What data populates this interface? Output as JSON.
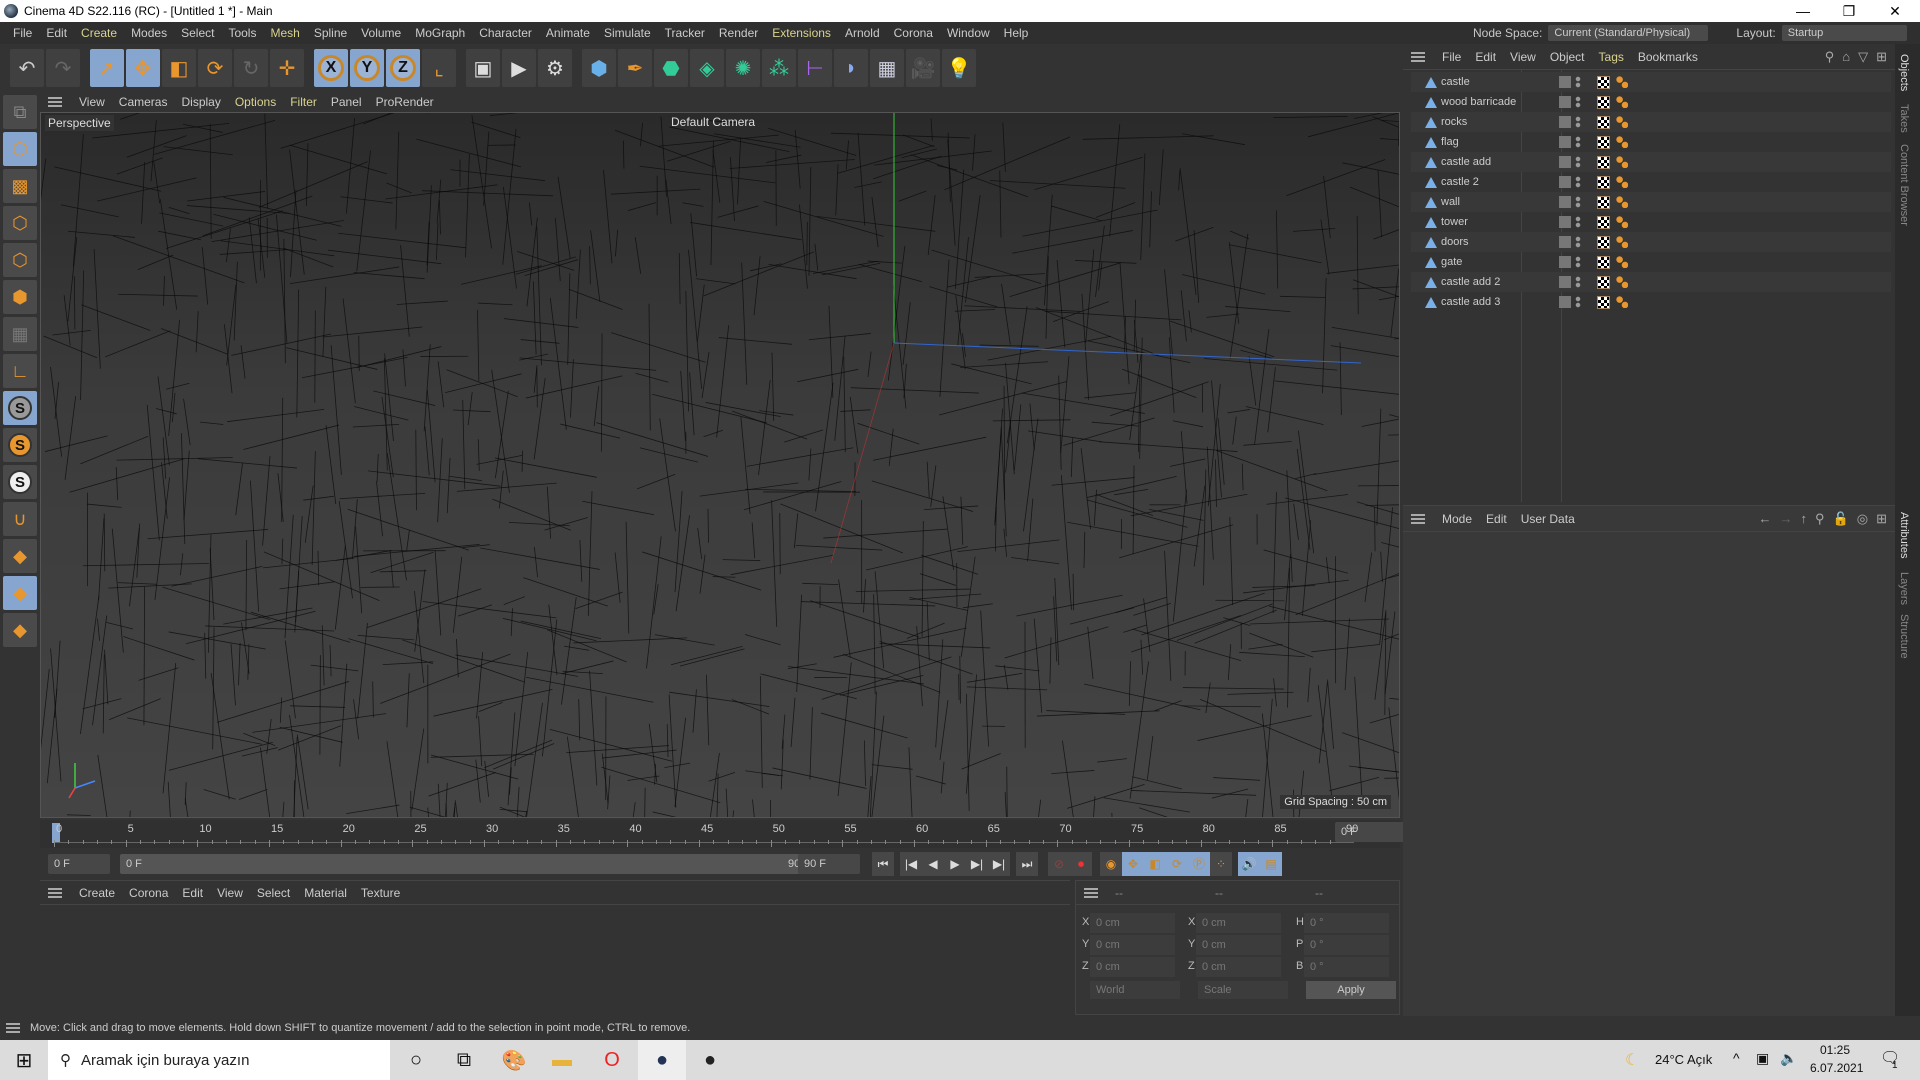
{
  "window": {
    "title": "Cinema 4D S22.116 (RC) - [Untitled 1 *] - Main",
    "minimize": "—",
    "restore": "❐",
    "close": "✕"
  },
  "menubar": [
    "File",
    "Edit",
    "Create",
    "Modes",
    "Select",
    "Tools",
    "Mesh",
    "Spline",
    "Volume",
    "MoGraph",
    "Character",
    "Animate",
    "Simulate",
    "Tracker",
    "Render",
    "Extensions",
    "Arnold",
    "Corona",
    "Window",
    "Help"
  ],
  "menubar_highlight": [
    "Create",
    "Mesh",
    "Extensions"
  ],
  "node_space": {
    "label": "Node Space:",
    "value": "Current (Standard/Physical)"
  },
  "layout": {
    "label": "Layout:",
    "value": "Startup"
  },
  "toolbar": {
    "x": "X",
    "y": "Y",
    "z": "Z"
  },
  "viewport": {
    "menu": [
      "View",
      "Cameras",
      "Display",
      "Options",
      "Filter",
      "Panel",
      "ProRender"
    ],
    "view_name": "Perspective",
    "camera": "Default Camera",
    "grid_spacing": "Grid Spacing : 50 cm"
  },
  "timeline": {
    "ticks": [
      "0",
      "5",
      "10",
      "15",
      "20",
      "25",
      "30",
      "35",
      "40",
      "45",
      "50",
      "55",
      "60",
      "65",
      "70",
      "75",
      "80",
      "85",
      "90"
    ],
    "current_frame": "0 F",
    "start": "0 F",
    "range_start": "0 F",
    "range_end": "90 F",
    "end": "90 F"
  },
  "material_menu": [
    "Create",
    "Corona",
    "Edit",
    "View",
    "Select",
    "Material",
    "Texture"
  ],
  "coords": {
    "headers": [
      "--",
      "--",
      "--"
    ],
    "rows": [
      {
        "a": "X",
        "av": "0 cm",
        "b": "X",
        "bv": "0 cm",
        "c": "H",
        "cv": "0 °"
      },
      {
        "a": "Y",
        "av": "0 cm",
        "b": "Y",
        "bv": "0 cm",
        "c": "P",
        "cv": "0 °"
      },
      {
        "a": "Z",
        "av": "0 cm",
        "b": "Z",
        "bv": "0 cm",
        "c": "B",
        "cv": "0 °"
      }
    ],
    "space": "World",
    "mode": "Scale",
    "apply": "Apply"
  },
  "objects": {
    "menu": [
      "File",
      "Edit",
      "View",
      "Object",
      "Tags",
      "Bookmarks"
    ],
    "items": [
      "castle",
      "wood barricade",
      "rocks",
      "flag",
      "castle add",
      "castle 2",
      "wall",
      "tower",
      "doors",
      "gate",
      "castle add 2",
      "castle add 3"
    ]
  },
  "attributes": {
    "menu": [
      "Mode",
      "Edit",
      "User Data"
    ]
  },
  "side_tabs": {
    "top": [
      "Objects",
      "Takes",
      "Content Browser"
    ],
    "bottom": [
      "Attributes",
      "Layers",
      "Structure"
    ]
  },
  "status": "Move: Click and drag to move elements. Hold down SHIFT to quantize movement / add to the selection in point mode, CTRL to remove.",
  "taskbar": {
    "search_placeholder": "Aramak için buraya yazın",
    "weather": "24°C  Açık",
    "time": "01:25",
    "date": "6.07.2021",
    "notifications": "1"
  }
}
